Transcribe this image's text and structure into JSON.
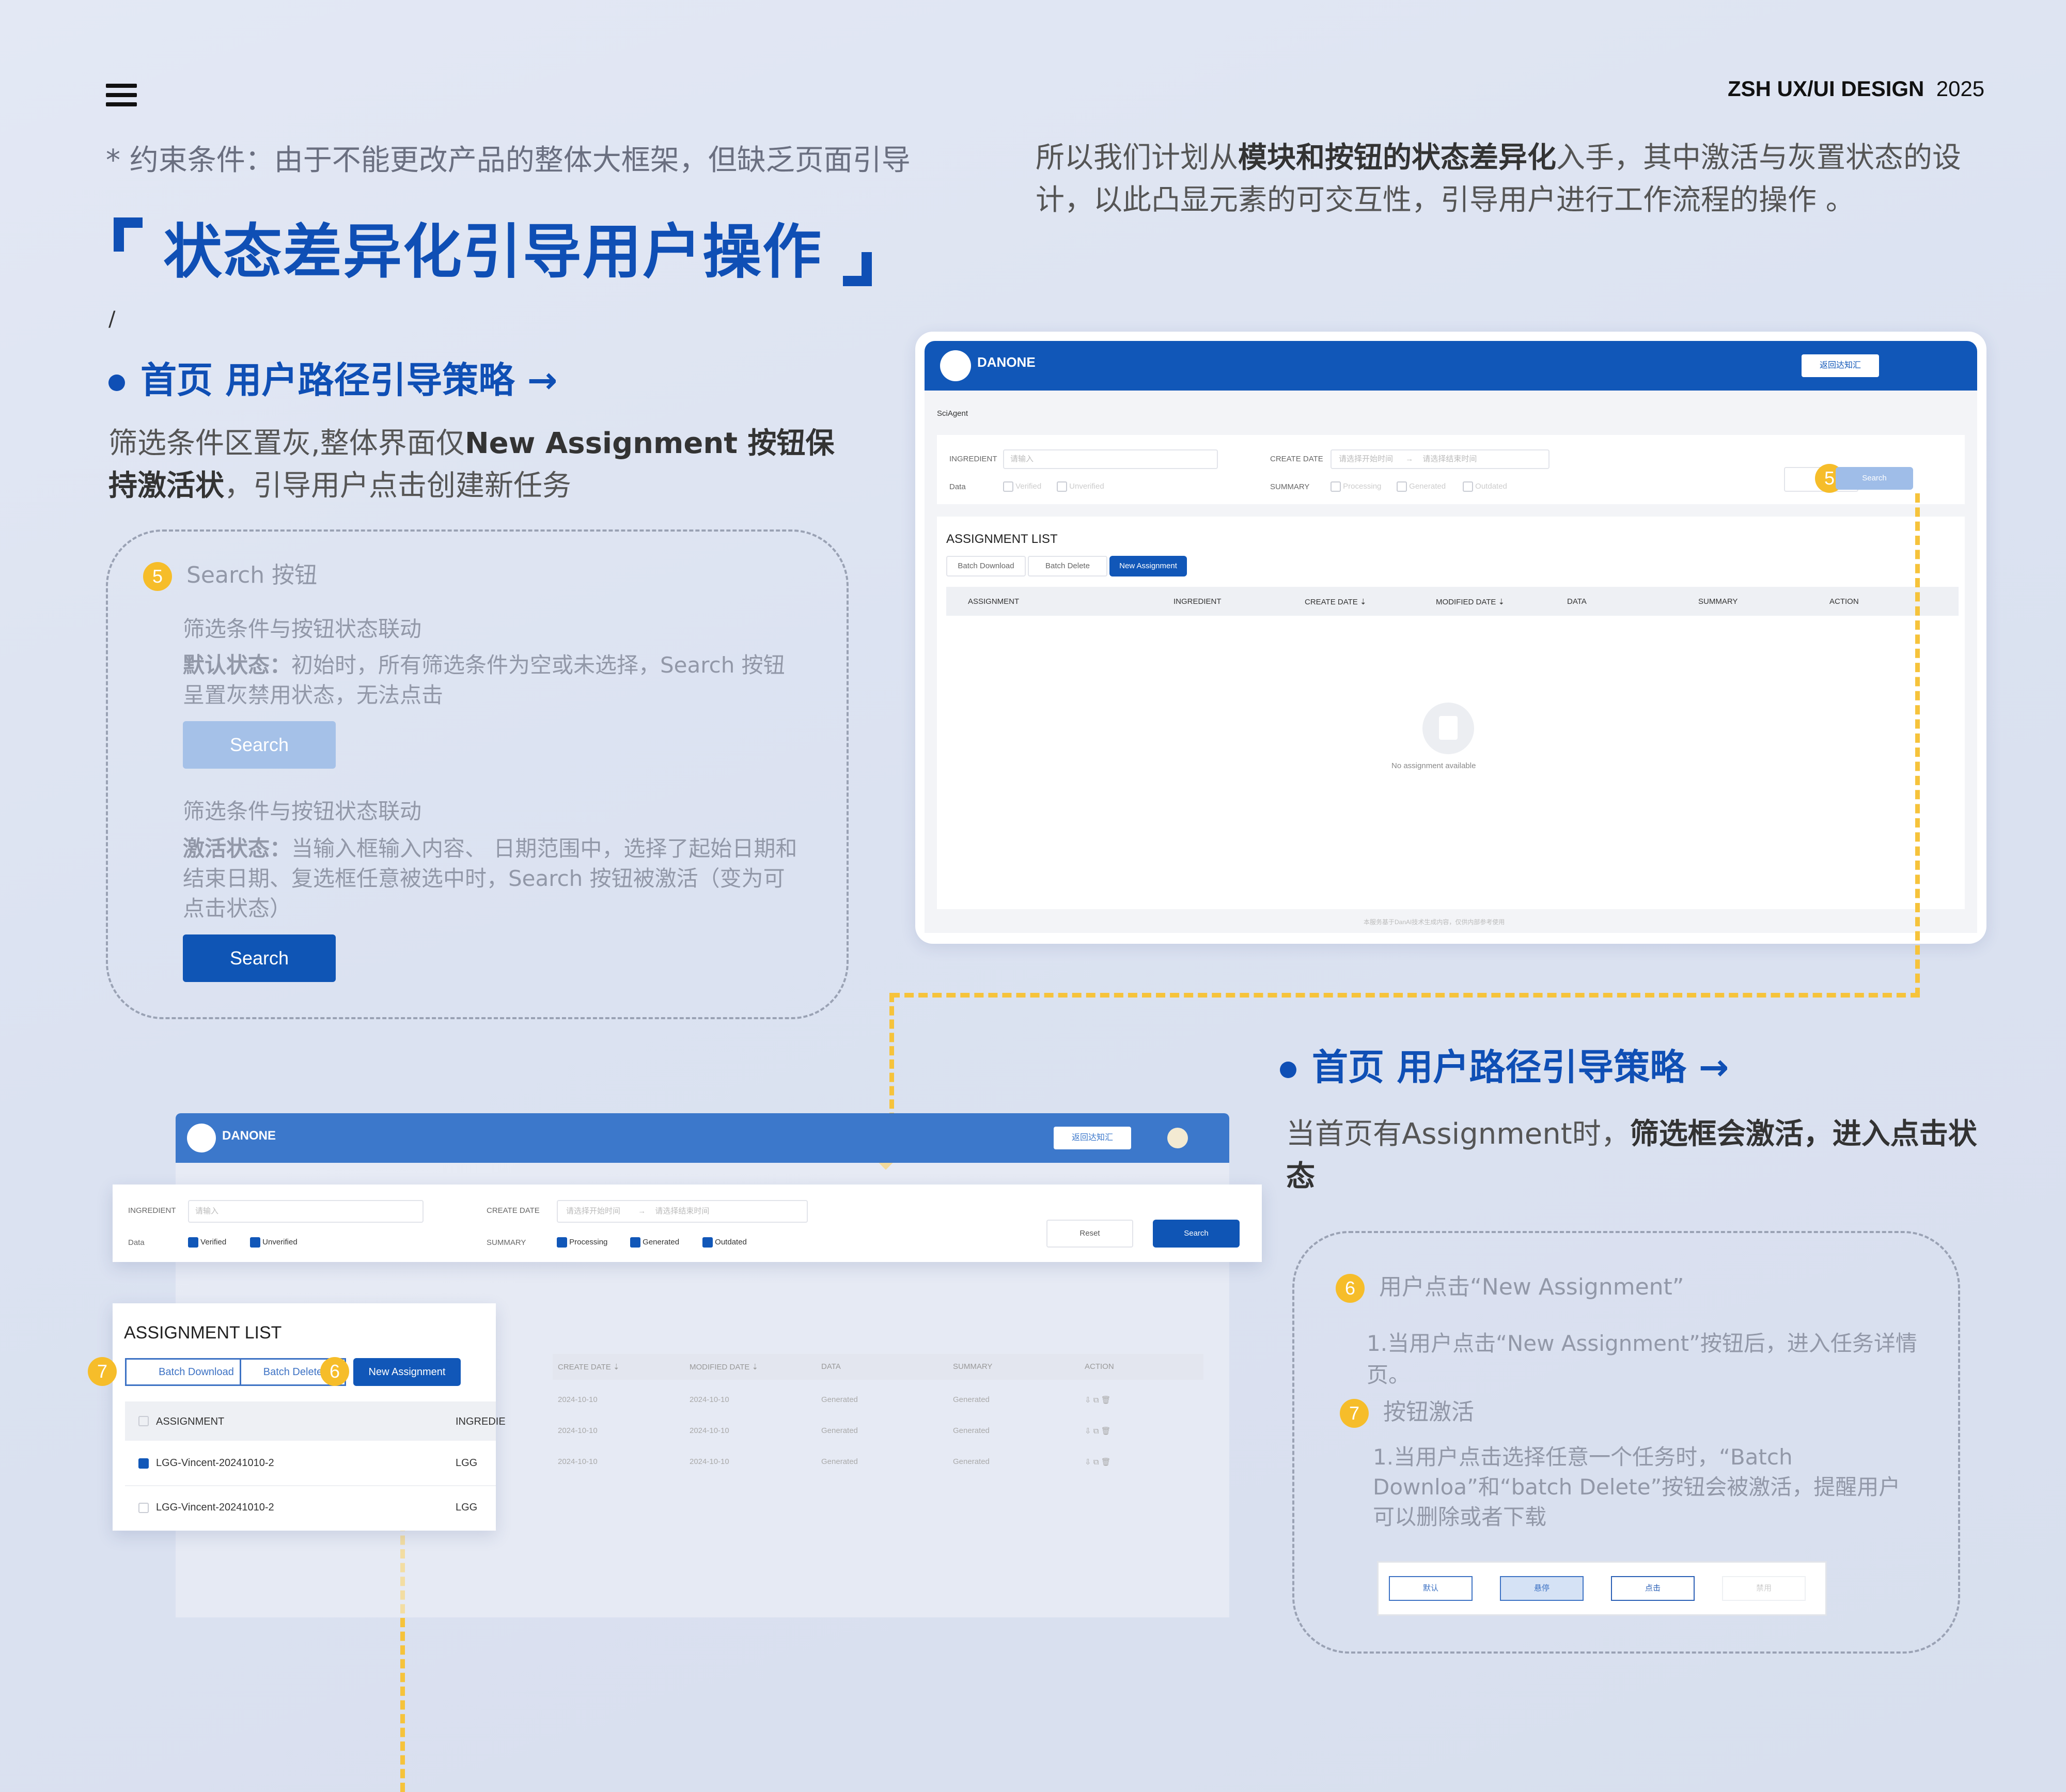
{
  "header": {
    "brand": "ZSH UX/UI DESIGN",
    "year": "2025",
    "menu_icon": "hamburger-icon"
  },
  "intro": {
    "constraint": "* 约束条件：由于不能更改产品的整体大框架，但缺乏页面引导",
    "title": "状态差异化引导用户操作",
    "right_pre": "所以我们计划从",
    "right_bold": "模块和按钮的状态差异化",
    "right_post": "入手，其中激活与灰置状态的设计，以此凸显元素的可交互性，引导用户进行工作流程的操作 。",
    "slash": "/"
  },
  "section1": {
    "heading": "首页 用户路径引导策略 →",
    "desc_pre": "筛选条件区置灰,整体界面仅",
    "desc_bold": "New Assignment 按钮保持激活状",
    "desc_post": "，引导用户点击创建新任务",
    "card": {
      "num": "5",
      "title": "Search 按钮",
      "sub1": "筛选条件与按钮状态联动",
      "default_label": "默认状态：",
      "default_text": "初始时，所有筛选条件为空或未选择，Search 按钮呈置灰禁用状态，无法点击",
      "sub2": "筛选条件与按钮状态联动",
      "active_label": "激活状态：",
      "active_text": "当输入框输入内容、 日期范围中，选择了起始日期和结束日期、复选框任意被选中时，Search 按钮被激活（变为可点击状态）",
      "btn_disabled": "Search",
      "btn_active": "Search"
    }
  },
  "section2": {
    "heading": "首页 用户路径引导策略 →",
    "desc_pre": "当首页有Assignment时，",
    "desc_bold": "筛选框会激活，进入点击状态",
    "card": {
      "num6": "6",
      "title6": "用户点击“New Assignment”",
      "text6": "1.当用户点击“New Assignment”按钮后，进入任务详情页。",
      "num7": "7",
      "title7": "按钮激活",
      "text7": "1.当用户点击选择任意一个任务时，“Batch Downloa”和“batch Delete”按钮会被激活，提醒用户可以删除或者下载",
      "states": [
        "默认",
        "悬停",
        "点击",
        "禁用"
      ]
    }
  },
  "app1": {
    "logo": "DANONE",
    "header_btn": "返回达知汇",
    "crumb": "SciAgent",
    "filters": {
      "ingredient": "INGREDIENT",
      "ingredient_ph": "请输入",
      "create_date": "CREATE DATE",
      "date_start": "请选择开始时间",
      "date_end": "请选择结束时间",
      "data": "Data",
      "verified": "Verified",
      "unverified": "Unverified",
      "summary": "SUMMARY",
      "processing": "Processing",
      "generated": "Generated",
      "outdated": "Outdated",
      "reset": "Re",
      "search": "Search",
      "num": "5"
    },
    "list_title": "ASSIGNMENT LIST",
    "buttons": [
      "Batch Download",
      "Batch Delete",
      "New Assignment"
    ],
    "columns": [
      "ASSIGNMENT",
      "INGREDIENT",
      "CREATE DATE ⇣",
      "MODIFIED DATE ⇣",
      "DATA",
      "SUMMARY",
      "ACTION"
    ],
    "empty": "No assignment available",
    "footer": "本服务基于DanAI技术生成内容，仅供内部参考使用"
  },
  "app2": {
    "logo": "DANONE",
    "header_btn": "返回达知汇",
    "filters": {
      "ingredient": "INGREDIENT",
      "ingredient_ph": "请输入",
      "create_date": "CREATE DATE",
      "date_start": "请选择开始时间",
      "date_end": "请选择结束时间",
      "data": "Data",
      "verified": "Verified",
      "unverified": "Unverified",
      "summary": "SUMMARY",
      "processing": "Processing",
      "generated": "Generated",
      "outdated": "Outdated",
      "reset": "Reset",
      "search": "Search"
    },
    "list_title": "ASSIGNMENT LIST",
    "btn_download": "Batch Download",
    "btn_delete": "Batch Delete",
    "btn_new": "New Assignment",
    "num7": "7",
    "num6": "6",
    "col_assignment": "ASSIGNMENT",
    "col_ingredient": "INGREDIE",
    "rows": [
      {
        "name": "LGG-Vincent-20241010-2",
        "ingredient": "LGG",
        "checked": true
      },
      {
        "name": "LGG-Vincent-20241010-2",
        "ingredient": "LGG",
        "checked": false
      }
    ],
    "bg_columns": [
      "CREATE DATE ⇣",
      "MODIFIED DATE ⇣",
      "DATA",
      "SUMMARY",
      "ACTION"
    ],
    "bg_rows": [
      [
        "2024-10-10",
        "2024-10-10",
        "Generated",
        "Generated"
      ],
      [
        "2024-10-10",
        "2024-10-10",
        "Generated",
        "Generated"
      ],
      [
        "2024-10-10",
        "2024-10-10",
        "Generated",
        "Generated"
      ]
    ]
  }
}
